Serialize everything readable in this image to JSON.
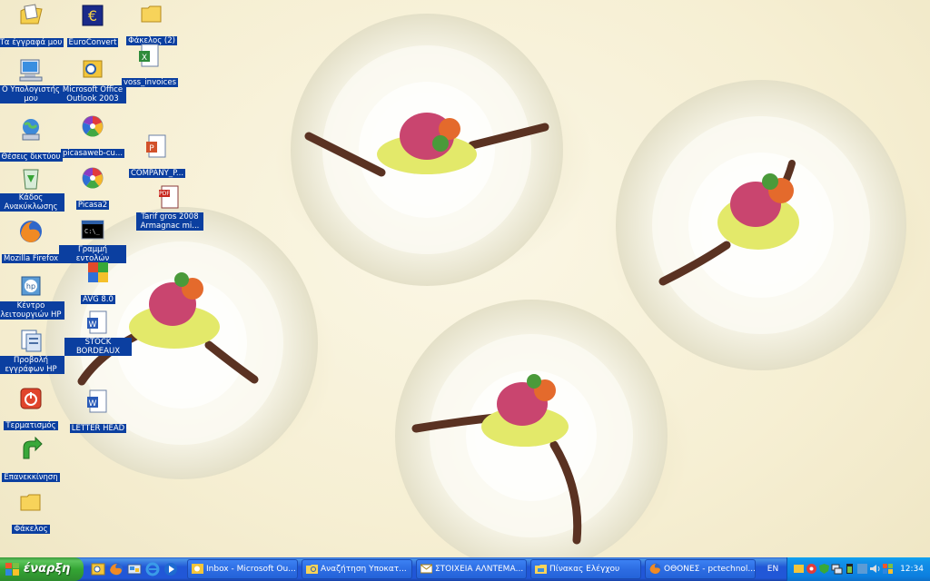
{
  "desktop": {
    "icons": [
      {
        "label": "Τα έγγραφά μου",
        "icon": "my-documents-icon"
      },
      {
        "label": "Ο Υπολογιστής μου",
        "icon": "my-computer-icon"
      },
      {
        "label": "Θέσεις δικτύου",
        "icon": "network-places-icon"
      },
      {
        "label": "Κάδος Ανακύκλωσης",
        "icon": "recycle-bin-icon"
      },
      {
        "label": "Mozilla Firefox",
        "icon": "firefox-icon"
      },
      {
        "label": "Κέντρο λειτουργιών HP",
        "icon": "hp-solution-center-icon"
      },
      {
        "label": "Προβολή εγγράφων HP",
        "icon": "hp-document-viewer-icon"
      },
      {
        "label": "Τερματισμός",
        "icon": "shutdown-icon"
      },
      {
        "label": "Επανεκκίνηση",
        "icon": "restart-icon"
      },
      {
        "label": "Φάκελος",
        "icon": "folder-icon"
      },
      {
        "label": "EuroConvert",
        "icon": "euro-icon"
      },
      {
        "label": "Microsoft Office Outlook 2003",
        "icon": "outlook-icon"
      },
      {
        "label": "picasaweb-cu...",
        "icon": "picasa-icon"
      },
      {
        "label": "Picasa2",
        "icon": "picasa-icon"
      },
      {
        "label": "Γραμμή εντολών",
        "icon": "command-prompt-icon"
      },
      {
        "label": "AVG 8.0",
        "icon": "avg-icon"
      },
      {
        "label": "STOCK BORDEAUX",
        "icon": "word-document-icon"
      },
      {
        "label": "LETTER HEAD",
        "icon": "word-document-icon"
      },
      {
        "label": "Φάκελος (2)",
        "icon": "folder-icon"
      },
      {
        "label": "voss_invoices",
        "icon": "excel-document-icon"
      },
      {
        "label": "COMPANY_P...",
        "icon": "powerpoint-document-icon"
      },
      {
        "label": "Tarif gros 2008 Armagnac mi...",
        "icon": "pdf-document-icon"
      }
    ]
  },
  "taskbar": {
    "start_label": "έναρξη",
    "quick_launch": [
      "outlook-icon",
      "firefox-icon",
      "show-desktop-icon",
      "internet-explorer-icon",
      "media-player-icon"
    ],
    "tasks": [
      {
        "label": "Inbox - Microsoft Ou...",
        "icon": "outlook-icon"
      },
      {
        "label": "Αναζήτηση Υποκατ...",
        "icon": "search-window-icon"
      },
      {
        "label": "ΣΤΟΙΧΕΙΑ ΑΛΝΤΕΜΑ...",
        "icon": "mail-message-icon"
      },
      {
        "label": "Πίνακας Ελέγχου",
        "icon": "control-panel-icon"
      },
      {
        "label": "ΟΘΟΝΕΣ - pctechnol...",
        "icon": "firefox-icon"
      }
    ],
    "language": "EN",
    "clock": "12:34"
  },
  "colors": {
    "icon_label_bg": "#0b3fa0",
    "taskbar_blue": "#2157d7",
    "start_green": "#34a534",
    "tray_blue": "#0c7fdf"
  }
}
